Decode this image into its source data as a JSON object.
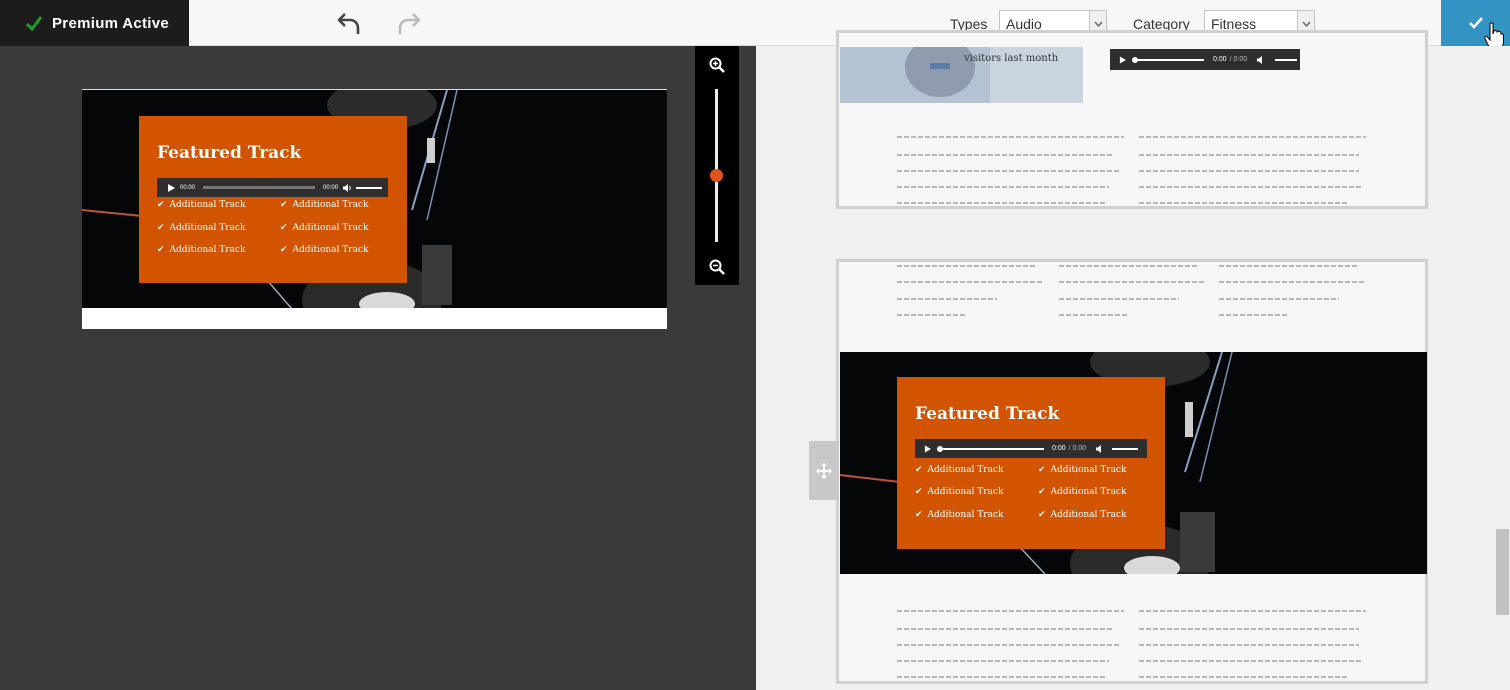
{
  "premium": {
    "label": "Premium Active"
  },
  "toolbar": {
    "types_label": "Types",
    "types_value": "Audio",
    "category_label": "Category",
    "category_value": "Fitness"
  },
  "featured": {
    "title": "Featured Track",
    "time_start_small": "00:00",
    "time_end_small": "00:00",
    "time_current": "0:00",
    "time_total": "/ 0:00",
    "tracks": [
      "Additional Track",
      "Additional Track",
      "Additional Track",
      "Additional Track",
      "Additional Track",
      "Additional Track"
    ]
  },
  "top_template": {
    "visitors_text": "visitors last month"
  },
  "colors": {
    "accent": "#d35400",
    "confirm": "#3393c3",
    "premium_bg": "#1c1c1c",
    "check_green": "#1e9e2e"
  }
}
